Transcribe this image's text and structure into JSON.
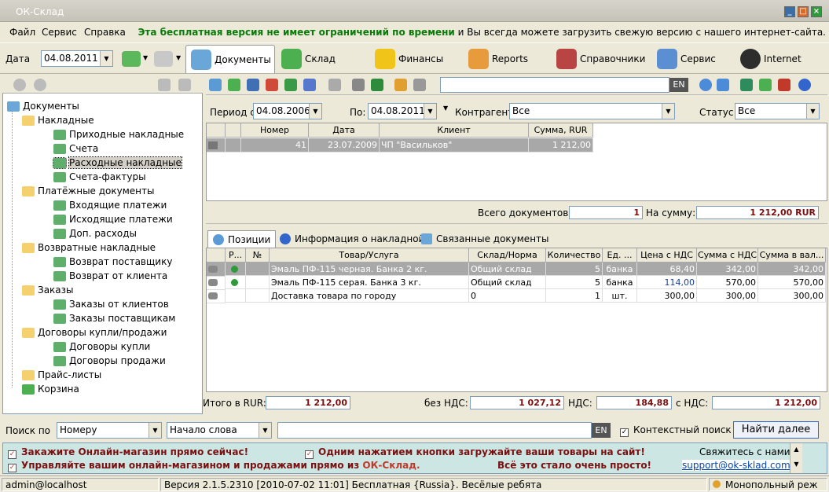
{
  "window": {
    "title": "ОК-Склад"
  },
  "menu": {
    "file": "Файл",
    "service": "Сервис",
    "help": "Справка",
    "promo_bold": "Эта бесплатная версия не имеет ограничений по времени",
    "promo_rest": " и Вы всегда можете загрузить свежую версию с нашего интернет-сайта."
  },
  "nav": {
    "date_label": "Дата",
    "date_value": "04.08.2011",
    "documents": "Документы",
    "warehouse": "Склад",
    "finance": "Финансы",
    "reports": "Reports",
    "directories": "Справочники",
    "service": "Сервис",
    "internet": "Internet"
  },
  "tree": {
    "root": "Документы",
    "items": [
      {
        "label": "Накладные",
        "level": 1
      },
      {
        "label": "Приходные накладные",
        "level": 2
      },
      {
        "label": "Счета",
        "level": 2
      },
      {
        "label": "Расходные накладные",
        "level": 2
      },
      {
        "label": "Счета-фактуры",
        "level": 2
      },
      {
        "label": "Платёжные документы",
        "level": 1
      },
      {
        "label": "Входящие платежи",
        "level": 2
      },
      {
        "label": "Исходящие платежи",
        "level": 2
      },
      {
        "label": "Доп. расходы",
        "level": 2
      },
      {
        "label": "Возвратные накладные",
        "level": 1
      },
      {
        "label": "Возврат поставщику",
        "level": 2
      },
      {
        "label": "Возврат от клиента",
        "level": 2
      },
      {
        "label": "Заказы",
        "level": 1
      },
      {
        "label": "Заказы от клиентов",
        "level": 2
      },
      {
        "label": "Заказы поставщикам",
        "level": 2
      },
      {
        "label": "Договоры купли/продажи",
        "level": 1
      },
      {
        "label": "Договоры купли",
        "level": 2
      },
      {
        "label": "Договоры продажи",
        "level": 2
      },
      {
        "label": "Прайс-листы",
        "level": 1
      }
    ],
    "trash": "Корзина"
  },
  "search_top": {
    "lang": "EN"
  },
  "filter": {
    "period_label": "Период с",
    "period_from": "04.08.2006",
    "to_label": "По:",
    "period_to": "04.08.2011",
    "contractor_label": "Контрагент",
    "contractor_value": "Все",
    "status_label": "Статус",
    "status_value": "Все"
  },
  "docs": {
    "headers": [
      "Номер",
      "Дата",
      "Клиент",
      "Сумма, RUR"
    ],
    "rows": [
      [
        "41",
        "23.07.2009",
        "ЧП \"Васильков\"",
        "1 212,00"
      ]
    ],
    "total_docs_label": "Всего документов:",
    "total_docs": "1",
    "total_sum_label": "На сумму:",
    "total_sum": "1 212,00 RUR"
  },
  "tabs": {
    "positions": "Позиции",
    "info": "Информация о накладной",
    "related": "Связанные документы"
  },
  "items": {
    "headers": [
      "Р...",
      "№",
      "Товар/Услуга",
      "Склад/Норма",
      "Количество",
      "Ед. ...",
      "Цена с НДС",
      "Сумма с НДС",
      "Сумма в вал..."
    ],
    "rows": [
      [
        "",
        "",
        "Эмаль ПФ-115 черная. Банка 2 кг.",
        "Общий склад",
        "5",
        "банка",
        "68,40",
        "342,00",
        "342,00"
      ],
      [
        "",
        "",
        "Эмаль ПФ-115 серая. Банка 3 кг.",
        "Общий склад",
        "5",
        "банка",
        "114,00",
        "570,00",
        "570,00"
      ],
      [
        "",
        "",
        "Доставка товара по городу",
        "0",
        "1",
        "шт.",
        "300,00",
        "300,00",
        "300,00"
      ]
    ]
  },
  "totals": {
    "total_label": "Итого в RUR:",
    "total": "1 212,00",
    "no_vat_label": "без НДС:",
    "no_vat": "1 027,12",
    "vat_label": "НДС:",
    "vat": "184,88",
    "with_vat_label": "с НДС:",
    "with_vat": "1 212,00"
  },
  "search": {
    "label": "Поиск по",
    "field": "Номеру",
    "mode": "Начало слова",
    "lang": "EN",
    "context_label": "Контекстный поиск",
    "find_next": "Найти далее"
  },
  "ads": {
    "a1": "Закажите Онлайн-магазин прямо сейчас!",
    "a2": "Одним нажатием кнопки загружайте ваши товары на сайт!",
    "a3": "Управляйте вашим онлайн-магазином и продажами прямо из ",
    "a3_brand": "ОК-Склад.",
    "a4": "Всё это стало очень просто!",
    "contact": "Свяжитесь с нами",
    "email": "support@ok-sklad.com"
  },
  "status": {
    "user": "admin@localhost",
    "version": "Версия 2.1.5.2310 [2010-07-02 11:01] Бесплатная {Russia}. Весёлые ребята",
    "mode": "Монопольный реж"
  },
  "colors": {
    "accent_green": "#0a7a0a",
    "selected_row": "#a8a8a8",
    "ad_bg": "#cbe6e3",
    "ad_text": "#7a1010",
    "brand_red": "#c0392b"
  }
}
